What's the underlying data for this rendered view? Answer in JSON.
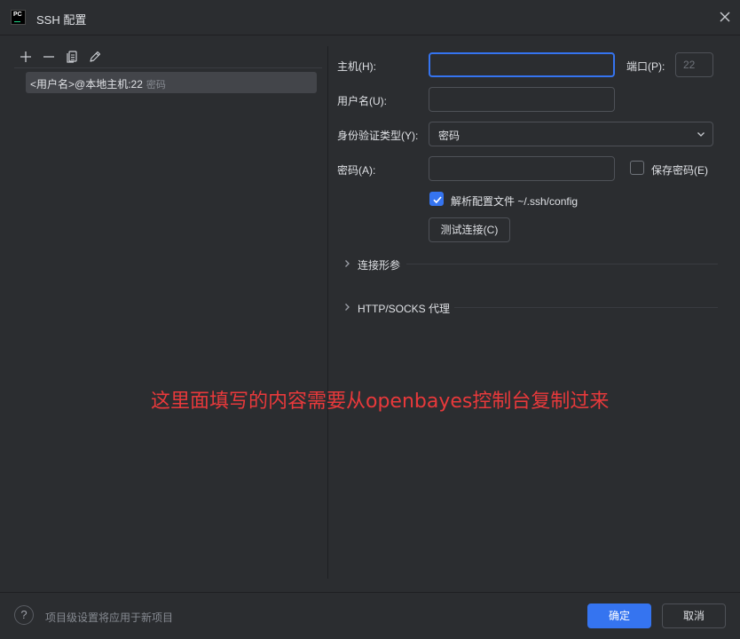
{
  "window": {
    "title": "SSH 配置",
    "logo_text": "PC"
  },
  "icons": {
    "app": "pycharm-logo-icon",
    "close": "close-icon",
    "add": "plus-icon",
    "remove": "minus-icon",
    "copy": "copy-icon",
    "edit": "pencil-icon",
    "dropdown": "chevron-down-icon",
    "expand": "chevron-right-icon",
    "check": "checkmark-icon",
    "help": "question-mark-icon"
  },
  "sidebar": {
    "items": [
      {
        "label": "<用户名>@本地主机:22",
        "auth": "密码"
      }
    ]
  },
  "form": {
    "host_label": "主机(H):",
    "host_value": "",
    "port_label": "端口(P):",
    "port_placeholder": "22",
    "username_label": "用户名(U):",
    "username_value": "",
    "auth_type_label": "身份验证类型(Y):",
    "auth_type_selected": "密码",
    "password_label": "密码(A):",
    "password_value": "",
    "save_password_label": "保存密码(E)",
    "save_password_checked": false,
    "parse_config_label": "解析配置文件 ~/.ssh/config",
    "parse_config_checked": true,
    "test_connection_label": "测试连接(C)"
  },
  "sections": [
    {
      "label": "连接形参"
    },
    {
      "label": "HTTP/SOCKS 代理"
    }
  ],
  "annotation": "这里面填写的内容需要从openbayes控制台复制过来",
  "footer": {
    "help_glyph": "?",
    "note": "项目级设置将应用于新项目",
    "ok_label": "确定",
    "cancel_label": "取消"
  },
  "colors": {
    "background": "#2b2d30",
    "accent": "#3574f0",
    "annotation": "#e8393b"
  }
}
